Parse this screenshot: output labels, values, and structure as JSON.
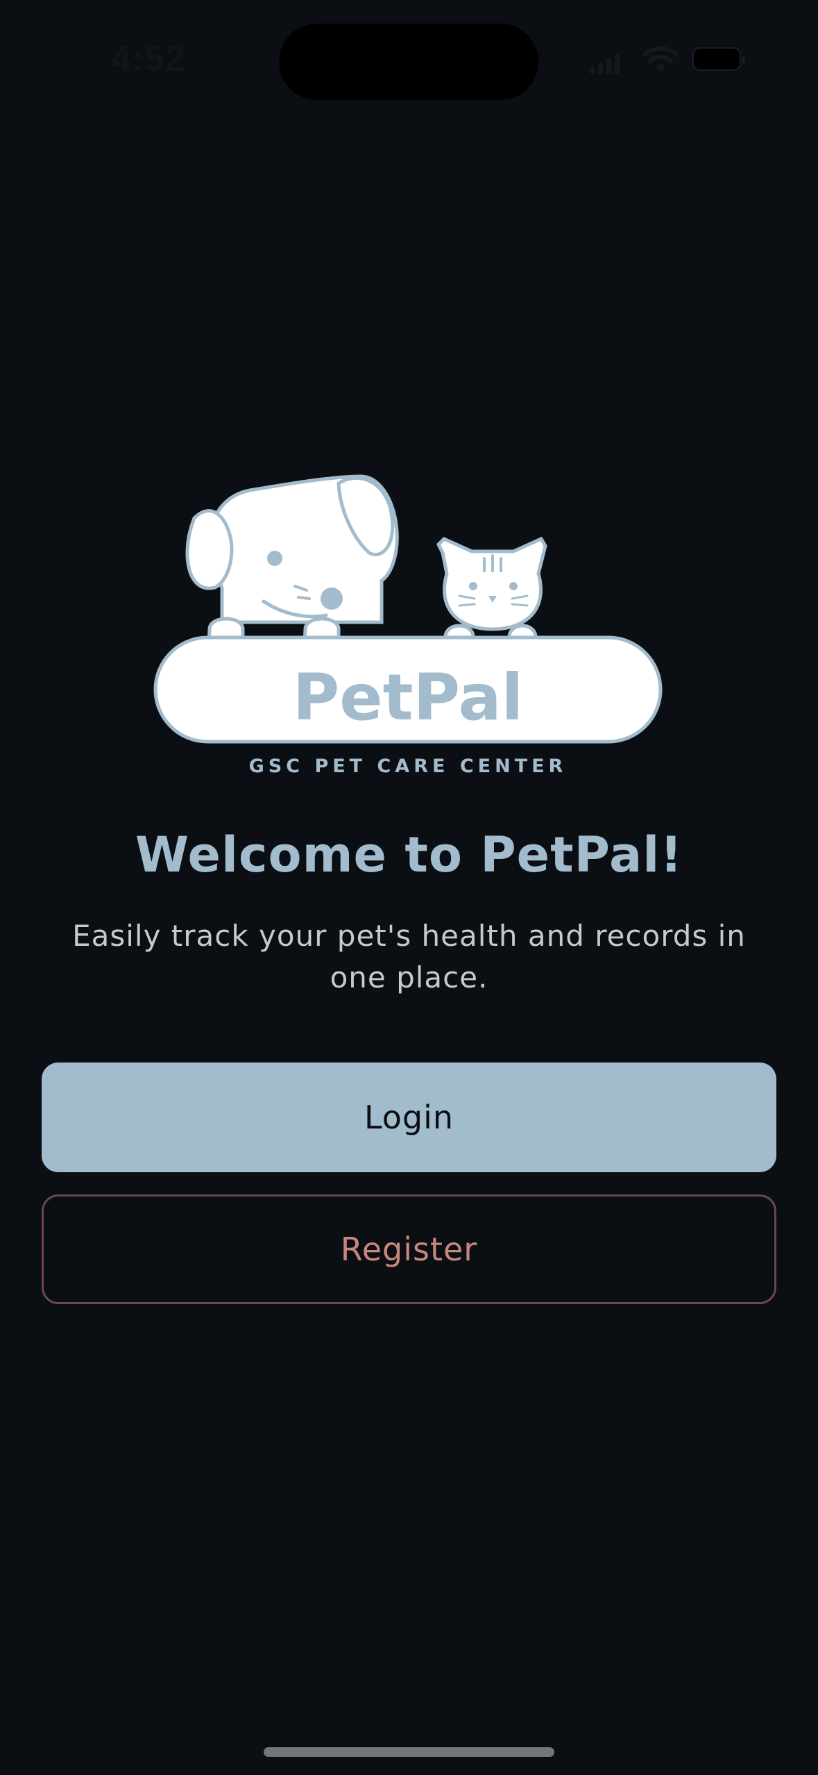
{
  "status_bar": {
    "time": "4:52",
    "icons": [
      "signal-icon",
      "wifi-icon",
      "battery-icon"
    ]
  },
  "logo": {
    "wordmark": "PetPal",
    "tagline": "GSC PET CARE CENTER"
  },
  "welcome": {
    "title": "Welcome to PetPal!",
    "subtitle": "Easily track your pet's health and records in one place."
  },
  "actions": {
    "login_label": "Login",
    "register_label": "Register"
  },
  "colors": {
    "background": "#0b0e12",
    "accent": "#a3bccd",
    "register_text": "#c8877c",
    "register_border": "#6e4650"
  }
}
